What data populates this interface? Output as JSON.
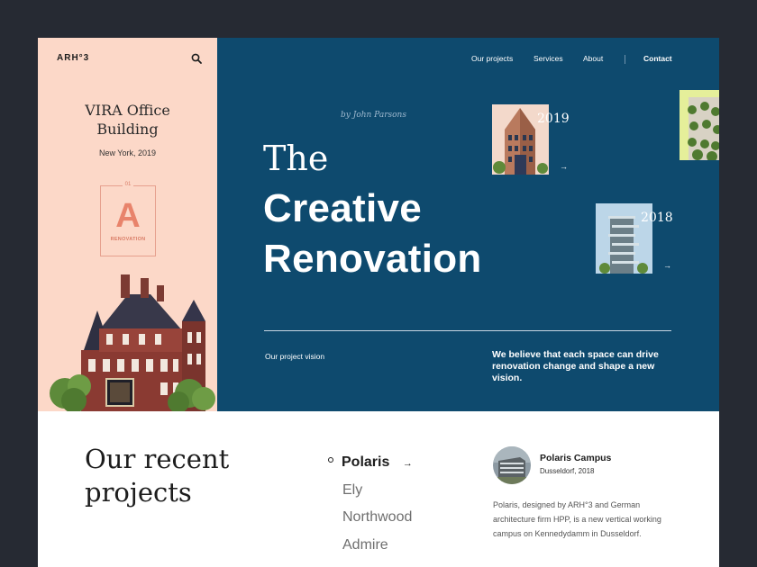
{
  "header": {
    "logo": "ARH°3",
    "nav": [
      "Our projects",
      "Services",
      "About"
    ],
    "contact": "Contact"
  },
  "feature": {
    "title_line1": "VIRA Office",
    "title_line2": "Building",
    "subtitle": "New York, 2019",
    "badge_number": "01",
    "badge_letter": "A",
    "badge_label": "RENOVATION"
  },
  "hero": {
    "signature": "by John Parsons",
    "line1": "The",
    "line2": "Creative",
    "line3": "Renovation",
    "thumbs": [
      {
        "year": "2019"
      },
      {
        "year": "2018"
      }
    ],
    "vision_label": "Our project vision",
    "vision_text": "We believe that each space can drive renovation change and shape a new vision."
  },
  "recent": {
    "title_line1": "Our recent",
    "title_line2": "projects",
    "projects": [
      "Polaris",
      "Ely",
      "Northwood",
      "Admire"
    ],
    "active_index": 0
  },
  "detail": {
    "name": "Polaris Campus",
    "location": "Dusseldorf, 2018",
    "description": "Polaris, designed by ARH°3 and German architecture firm HPP, is a new vertical working campus on Kennedydamm in Dusseldorf."
  },
  "colors": {
    "peach": "#fcd8c8",
    "navy": "#0e4a6e",
    "accent": "#e8836b"
  }
}
